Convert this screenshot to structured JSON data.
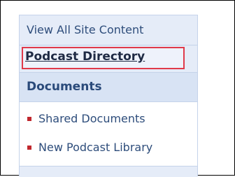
{
  "quick_launch": {
    "view_all_label": "View All Site Content",
    "podcast_directory_label": "Podcast Directory",
    "documents_heading": "Documents",
    "documents_items": [
      {
        "label": "Shared Documents"
      },
      {
        "label": "New Podcast Library"
      }
    ]
  },
  "colors": {
    "highlight_border": "#e03a4a",
    "bullet": "#c0272d",
    "nav_background": "#e5ecf8",
    "link_text": "#2e4d7b"
  }
}
